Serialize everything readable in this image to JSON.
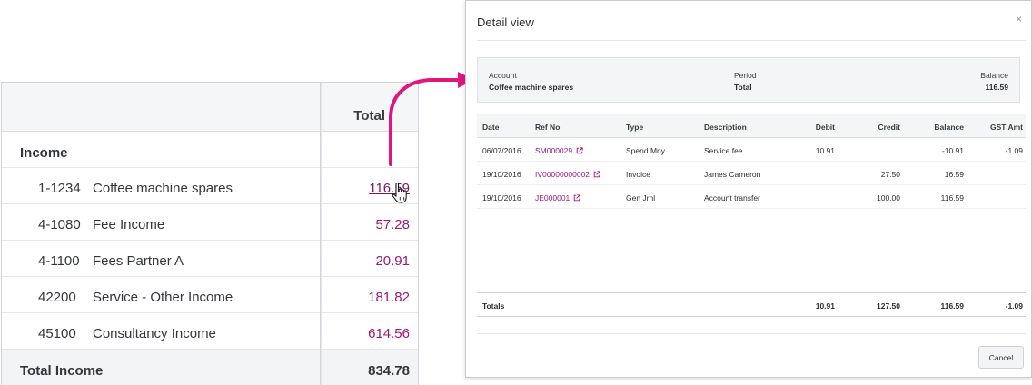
{
  "report": {
    "column_header": "Total",
    "section_label": "Income",
    "rows": [
      {
        "code": "1-1234",
        "name": "Coffee machine spares",
        "amount": "116.59"
      },
      {
        "code": "4-1080",
        "name": "Fee Income",
        "amount": "57.28"
      },
      {
        "code": "4-1100",
        "name": "Fees Partner A",
        "amount": "20.91"
      },
      {
        "code": "42200",
        "name": "Service - Other Income",
        "amount": "181.82"
      },
      {
        "code": "45100",
        "name": "Consultancy Income",
        "amount": "614.56"
      }
    ],
    "total_label": "Total Income",
    "total_amount": "834.78"
  },
  "modal": {
    "title": "Detail view",
    "close_glyph": "×",
    "info": {
      "account_label": "Account",
      "account_value": "Coffee machine spares",
      "period_label": "Period",
      "period_value": "Total",
      "balance_label": "Balance",
      "balance_value": "116.59"
    },
    "columns": [
      "Date",
      "Ref No",
      "Type",
      "Description",
      "Debit",
      "Credit",
      "Balance",
      "GST Amt"
    ],
    "rows": [
      {
        "date": "06/07/2016",
        "ref": "SM000029",
        "type": "Spend Mny",
        "description": "Service fee",
        "debit": "10.91",
        "credit": "",
        "balance": "-10.91",
        "gst": "-1.09"
      },
      {
        "date": "19/10/2016",
        "ref": "IV00000000002",
        "type": "Invoice",
        "description": "James Cameron",
        "debit": "",
        "credit": "27.50",
        "balance": "16.59",
        "gst": ""
      },
      {
        "date": "19/10/2016",
        "ref": "JE000001",
        "type": "Gen Jrnl",
        "description": "Account transfer",
        "debit": "",
        "credit": "100.00",
        "balance": "116.59",
        "gst": ""
      }
    ],
    "totals": {
      "label": "Totals",
      "debit": "10.91",
      "credit": "127.50",
      "balance": "116.59",
      "gst": "-1.09"
    },
    "cancel_label": "Cancel"
  },
  "colors": {
    "link": "#9b1a7a",
    "arrow": "#e0157f"
  },
  "icons": [
    "hand-pointer-icon",
    "external-link-icon",
    "curved-arrow-icon",
    "close-icon"
  ]
}
